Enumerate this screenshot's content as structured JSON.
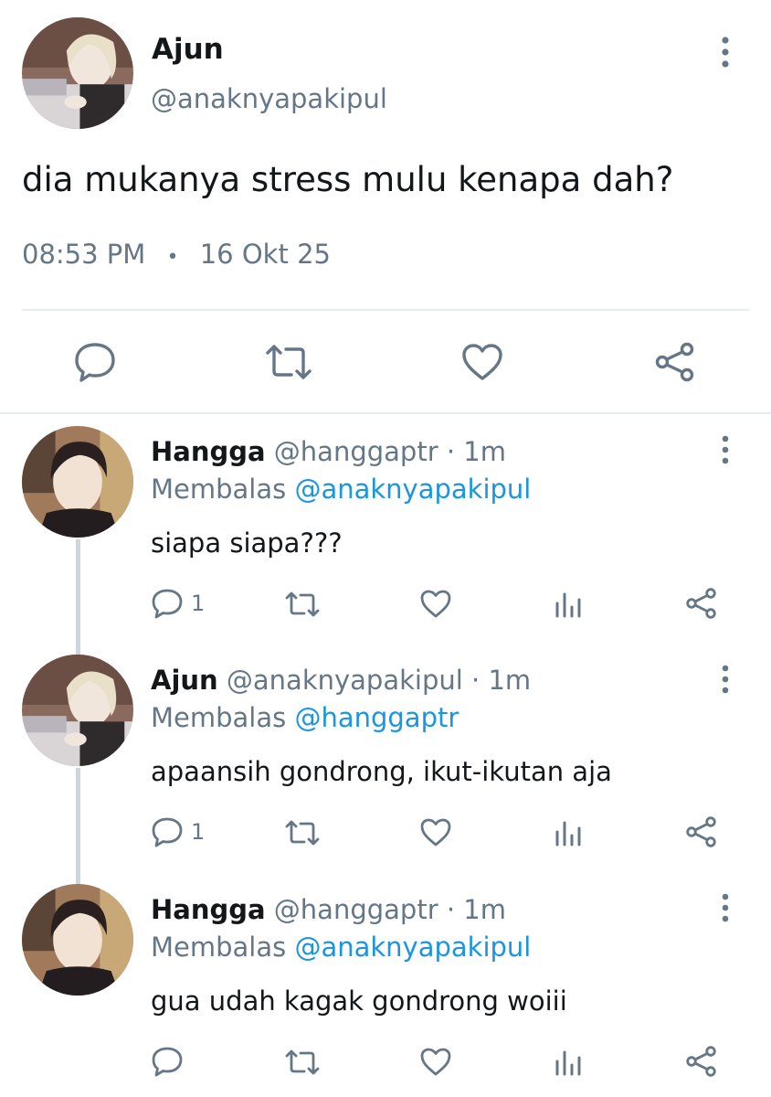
{
  "main_tweet": {
    "name": "Ajun",
    "handle": "@anaknyapakipul",
    "text": "dia mukanya stress mulu kenapa dah?",
    "time": "08:53 PM",
    "separator": "•",
    "date": "16 Okt 25"
  },
  "replies": [
    {
      "name": "Hangga",
      "handle": "@hanggaptr",
      "time": "· 1m",
      "replying_label": "Membalas",
      "replying_to": "@anaknyapakipul",
      "text": "siapa siapa???",
      "reply_count": "1"
    },
    {
      "name": "Ajun",
      "handle": "@anaknyapakipul",
      "time": "· 1m",
      "replying_label": "Membalas",
      "replying_to": "@hanggaptr",
      "text": "apaansih gondrong, ikut-ikutan aja",
      "reply_count": "1"
    },
    {
      "name": "Hangga",
      "handle": "@hanggaptr",
      "time": "· 1m",
      "replying_label": "Membalas",
      "replying_to": "@anaknyapakipul",
      "text": "gua udah kagak gondrong woiii",
      "reply_count": ""
    }
  ],
  "icons": {
    "reply": "reply-icon",
    "retweet": "retweet-icon",
    "like": "heart-icon",
    "analytics": "analytics-icon",
    "share": "share-icon",
    "more": "more-vertical-icon"
  },
  "colors": {
    "text": "#14171a",
    "muted": "#657786",
    "link": "#1b95e0",
    "divider": "#e6ecf0",
    "thread_line": "#ccd6dd"
  }
}
